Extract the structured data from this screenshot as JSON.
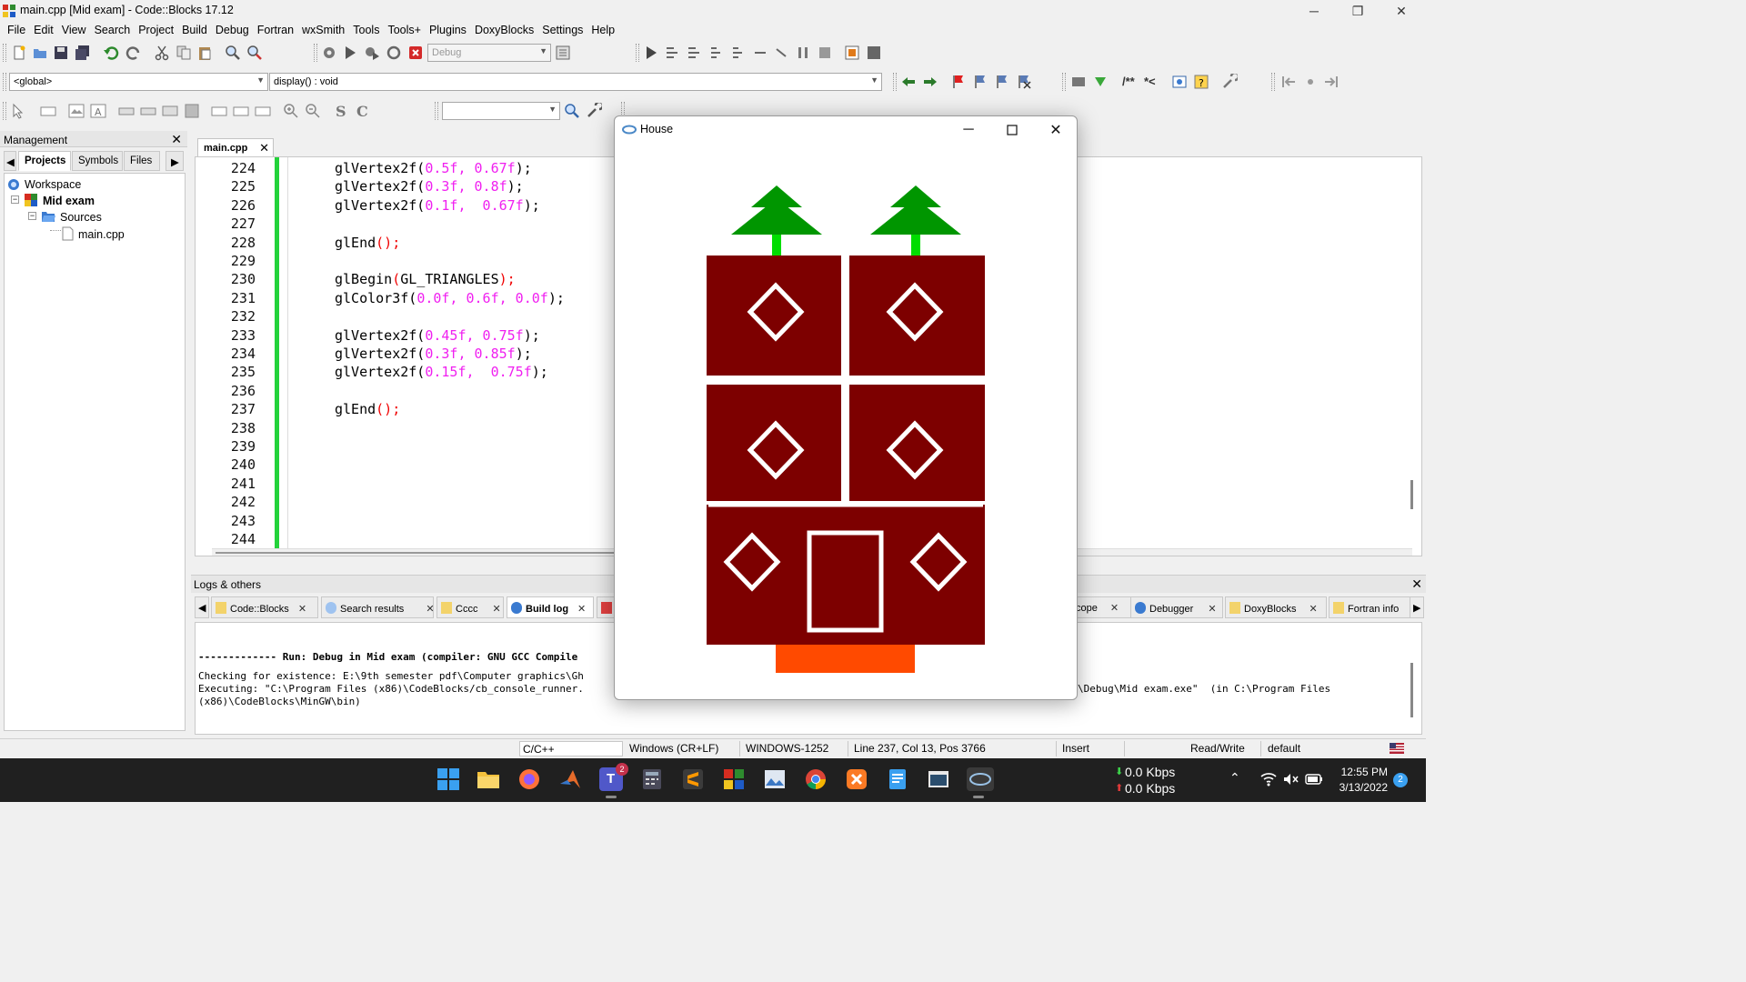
{
  "window": {
    "title": "main.cpp [Mid exam] - Code::Blocks 17.12",
    "controls": [
      "─",
      "❐",
      "✕"
    ]
  },
  "menu": [
    "File",
    "Edit",
    "View",
    "Search",
    "Project",
    "Build",
    "Debug",
    "Fortran",
    "wxSmith",
    "Tools",
    "Tools+",
    "Plugins",
    "DoxyBlocks",
    "Settings",
    "Help"
  ],
  "toolbar": {
    "build_target": "Debug",
    "scope": "<global>",
    "function": "display() : void",
    "doxy_labels": [
      "/**",
      "*<"
    ]
  },
  "management": {
    "title": "Management",
    "tabs": [
      "Projects",
      "Symbols",
      "Files"
    ],
    "tree": [
      {
        "label": "Workspace",
        "bold": false
      },
      {
        "label": "Mid exam",
        "bold": true
      },
      {
        "label": "Sources",
        "bold": false
      },
      {
        "label": "main.cpp",
        "bold": false
      }
    ]
  },
  "editor": {
    "tab": "main.cpp",
    "lines": [
      {
        "n": "224",
        "code": [
          [
            "",
            "glVertex2f("
          ],
          [
            "n",
            "0.5f, 0.67f"
          ],
          [
            "",
            ");"
          ]
        ]
      },
      {
        "n": "225",
        "code": [
          [
            "",
            "glVertex2f("
          ],
          [
            "n",
            "0.3f, 0.8f"
          ],
          [
            "",
            ");"
          ]
        ]
      },
      {
        "n": "226",
        "code": [
          [
            "",
            "glVertex2f("
          ],
          [
            "n",
            "0.1f,  0.67f"
          ],
          [
            "",
            ");"
          ]
        ]
      },
      {
        "n": "227",
        "code": []
      },
      {
        "n": "228",
        "code": [
          [
            "",
            "glEnd"
          ],
          [
            "p",
            "();"
          ]
        ]
      },
      {
        "n": "229",
        "code": []
      },
      {
        "n": "230",
        "code": [
          [
            "",
            "glBegin"
          ],
          [
            "p",
            "("
          ],
          [
            "",
            "GL_TRIANGLES"
          ],
          [
            "p",
            ");"
          ]
        ]
      },
      {
        "n": "231",
        "code": [
          [
            "",
            "glColor3f("
          ],
          [
            "n",
            "0.0f, 0.6f, 0.0f"
          ],
          [
            "",
            ");"
          ]
        ]
      },
      {
        "n": "232",
        "code": []
      },
      {
        "n": "233",
        "code": [
          [
            "",
            "glVertex2f("
          ],
          [
            "n",
            "0.45f, 0.75f"
          ],
          [
            "",
            ");"
          ]
        ]
      },
      {
        "n": "234",
        "code": [
          [
            "",
            "glVertex2f("
          ],
          [
            "n",
            "0.3f, 0.85f"
          ],
          [
            "",
            ");"
          ]
        ]
      },
      {
        "n": "235",
        "code": [
          [
            "",
            "glVertex2f("
          ],
          [
            "n",
            "0.15f,  0.75f"
          ],
          [
            "",
            ");"
          ]
        ]
      },
      {
        "n": "236",
        "code": []
      },
      {
        "n": "237",
        "code": [
          [
            "",
            "glEnd"
          ],
          [
            "p",
            "();"
          ]
        ]
      },
      {
        "n": "238",
        "code": []
      },
      {
        "n": "239",
        "code": []
      },
      {
        "n": "240",
        "code": []
      },
      {
        "n": "241",
        "code": []
      },
      {
        "n": "242",
        "code": []
      },
      {
        "n": "243",
        "code": []
      },
      {
        "n": "244",
        "code": []
      }
    ]
  },
  "logs": {
    "title": "Logs & others",
    "tabs_left": [
      "Code::Blocks",
      "Search results",
      "Cccc",
      "Build log"
    ],
    "tabs_right": [
      "cope",
      "Debugger",
      "DoxyBlocks",
      "Fortran info"
    ],
    "lines": [
      "------------- Run: Debug in Mid exam (compiler: GNU GCC Compile",
      "Checking for existence: E:\\9th semester pdf\\Computer graphics\\Gh",
      "Executing: \"C:\\Program Files (x86)\\CodeBlocks/cb_console_runner.",
      "(x86)\\CodeBlocks\\MinGW\\bin)"
    ],
    "line3_tail": "\\Debug\\Mid exam.exe\"  (in C:\\Program Files"
  },
  "statusbar": {
    "language": "C/C++",
    "eol": "Windows (CR+LF)",
    "encoding": "WINDOWS-1252",
    "position": "Line 237, Col 13, Pos 3766",
    "mode": "Insert",
    "access": "Read/Write",
    "profile": "default"
  },
  "taskbar": {
    "net_down": "0.0 Kbps",
    "net_up": "0.0 Kbps",
    "time": "12:55 PM",
    "date": "3/13/2022",
    "notifications": "2",
    "teams_badge": "2"
  },
  "house_window": {
    "title": "House",
    "colors": {
      "wall": "#7d0000",
      "tree": "#009600",
      "trunk": "#00dd00",
      "step": "#ff4a00",
      "outline": "#ffffff"
    }
  }
}
